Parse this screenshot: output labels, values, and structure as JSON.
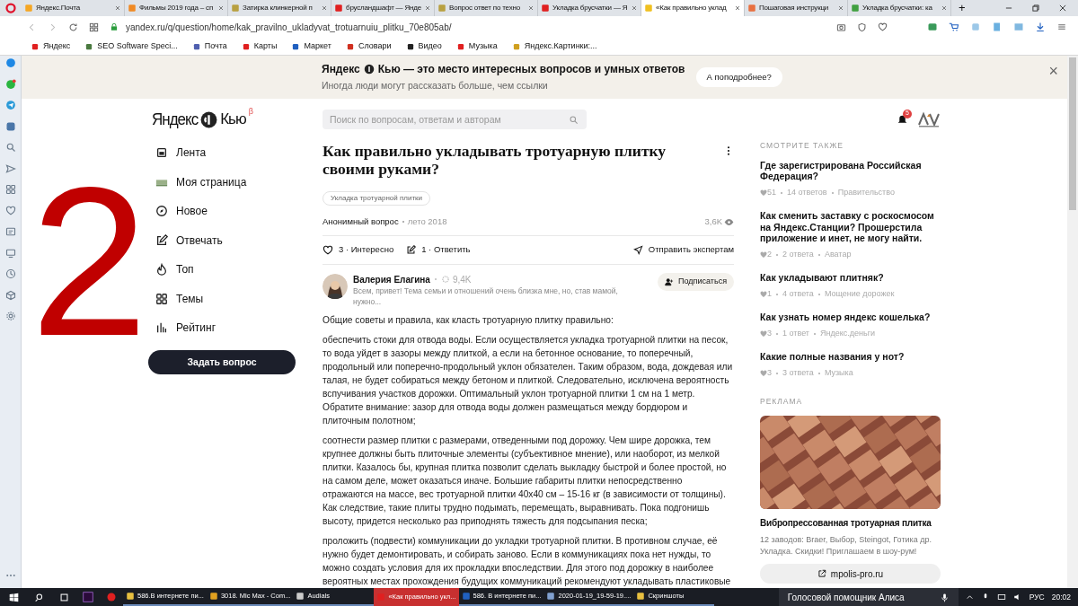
{
  "browser": {
    "tabs": [
      {
        "label": "Яндекс.Почта",
        "selected": false
      },
      {
        "label": "Фильмы 2019 года – сп",
        "selected": false
      },
      {
        "label": "Затирка клинкерной п",
        "selected": false
      },
      {
        "label": "брусландшафт — Янде",
        "selected": false
      },
      {
        "label": "Вопрос ответ по техно",
        "selected": false
      },
      {
        "label": "Укладка брусчатки — Я",
        "selected": false
      },
      {
        "label": "«Как правильно уклад",
        "selected": true
      },
      {
        "label": "Пошаговая инструкци",
        "selected": false
      },
      {
        "label": "Укладка брусчатки: ка",
        "selected": false
      }
    ],
    "new_tab": "+",
    "url": "yandex.ru/q/question/home/kak_pravilno_ukladyvat_trotuarnuiu_plitku_70e805ab/",
    "bookmarks": [
      "Яндекс",
      "SEO Software Speci...",
      "Почта",
      "Карты",
      "Маркет",
      "Словари",
      "Видео",
      "Музыка",
      "Яндекс.Картинки:..."
    ]
  },
  "banner": {
    "title_left": "Яндекс",
    "title_right": "Кью — это место интересных вопросов и умных ответов",
    "subtitle": "Иногда люди могут рассказать больше, чем ссылки",
    "button": "А поподробнее?",
    "close": "×"
  },
  "logo": {
    "left": "Яндекс",
    "right": "Кью",
    "badge": "β"
  },
  "nav": [
    "Лента",
    "Моя страница",
    "Новое",
    "Отвечать",
    "Топ",
    "Темы",
    "Рейтинг"
  ],
  "ask_button": "Задать вопрос",
  "search": {
    "placeholder": "Поиск по вопросам, ответам и авторам"
  },
  "notifications": {
    "count": "5"
  },
  "question": {
    "title": "Как правильно укладывать тротуарную плитку своими руками?",
    "tag": "Укладка тротуарной плитки",
    "author": "Анонимный вопрос",
    "date": "лето 2018",
    "views": "3,6K",
    "actions": {
      "interest": "3 · Интересно",
      "answer": "1 · Ответить",
      "send": "Отправить экспертам"
    }
  },
  "answer": {
    "author": "Валерия Елагина",
    "rating": "9,4K",
    "bio": "Всем, привет! Тема семьи и отношений очень близка мне, но, став мамой, нужно...",
    "subscribe": "Подписаться",
    "paragraphs": [
      "Общие советы и правила, как класть тротуарную плитку правильно:",
      "обеспечить стоки для отвода воды. Если осуществляется укладка тротуарной плитки на песок, то вода уйдет в зазоры между плиткой, а если на бетонное основание, то поперечный, продольный или поперечно-продольный уклон обязателен. Таким образом, вода, дождевая или талая, не будет собираться между бетоном и плиткой. Следовательно, исключена вероятность вспучивания участков дорожки. Оптимальный уклон тротуарной плитки 1 см на 1 метр. Обратите внимание: зазор для отвода воды должен размещаться между бордюром и плиточным полотном;",
      "соотнести размер плитки с размерами, отведенными под дорожку. Чем шире дорожка, тем крупнее должны быть плиточные элементы (субъективное мнение), или наоборот, из мелкой плитки. Казалось бы, крупная плитка позволит сделать выкладку быстрой и более простой, но на самом деле, может оказаться иначе. Большие габариты плитки непосредственно отражаются на массе, вес тротуарной плитки 40x40 см – 15-16 кг (в зависимости от толщины). Как следствие, такие плиты трудно подымать, перемещать, выравнивать. Пока подгонишь высоту, придется несколько раз приподнять тяжесть для подсыпания песка;",
      "проложить (подвести) коммуникации до укладки тротуарной плитки. В противном случае, её нужно будет демонтировать, и собирать заново. Если в коммуникациях пока нет нужды, то можно создать условия для их прокладки впоследствии. Для этого под дорожку в наиболее вероятных местах прохождения будущих коммуникаций рекомендуют укладывать пластиковые"
    ]
  },
  "see_also": {
    "heading": "СМОТРИТЕ ТАКЖЕ",
    "items": [
      {
        "title": "Где зарегистрирована Российская Федерация?",
        "likes": "51",
        "answers": "14 ответов",
        "topic": "Правительство"
      },
      {
        "title": "Как сменить заставку с роскосмосом на Яндекс.Станции? Прошерстила приложение и инет, не могу найти.",
        "likes": "2",
        "answers": "2 ответа",
        "topic": "Аватар"
      },
      {
        "title": "Как укладывают плитняк?",
        "likes": "1",
        "answers": "4 ответа",
        "topic": "Мощение дорожек"
      },
      {
        "title": "Как узнать номер яндекс кошелька?",
        "likes": "3",
        "answers": "1 ответ",
        "topic": "Яндекс.деньги"
      },
      {
        "title": "Какие полные названия у нот?",
        "likes": "3",
        "answers": "3 ответа",
        "topic": "Музыка"
      }
    ]
  },
  "ad": {
    "heading": "РЕКЛАМА",
    "title": "Вибропрессованная тротуарная плитка",
    "text": "12 заводов: Braer, Выбор, Steingot, Готика др. Укладка. Скидки! Приглашаем в шоу-рум!",
    "link": "mpolis-pro.ru"
  },
  "overlay_number": "2",
  "taskbar": {
    "items": [
      {
        "label": "586.В  интернете пи...",
        "selected": false
      },
      {
        "label": "3018. Mic Max - Com...",
        "selected": false
      },
      {
        "label": "Audials",
        "selected": false
      },
      {
        "label": "«Как правильно укл...",
        "selected": true
      },
      {
        "label": "586. В интернете пи...",
        "selected": false
      },
      {
        "label": "2020-01-19_19-59-19....",
        "selected": false
      },
      {
        "label": "Скриншоты",
        "selected": false
      }
    ],
    "assistant": "Голосовой помощник Алиса",
    "language": "РУС",
    "time": "20:02"
  }
}
